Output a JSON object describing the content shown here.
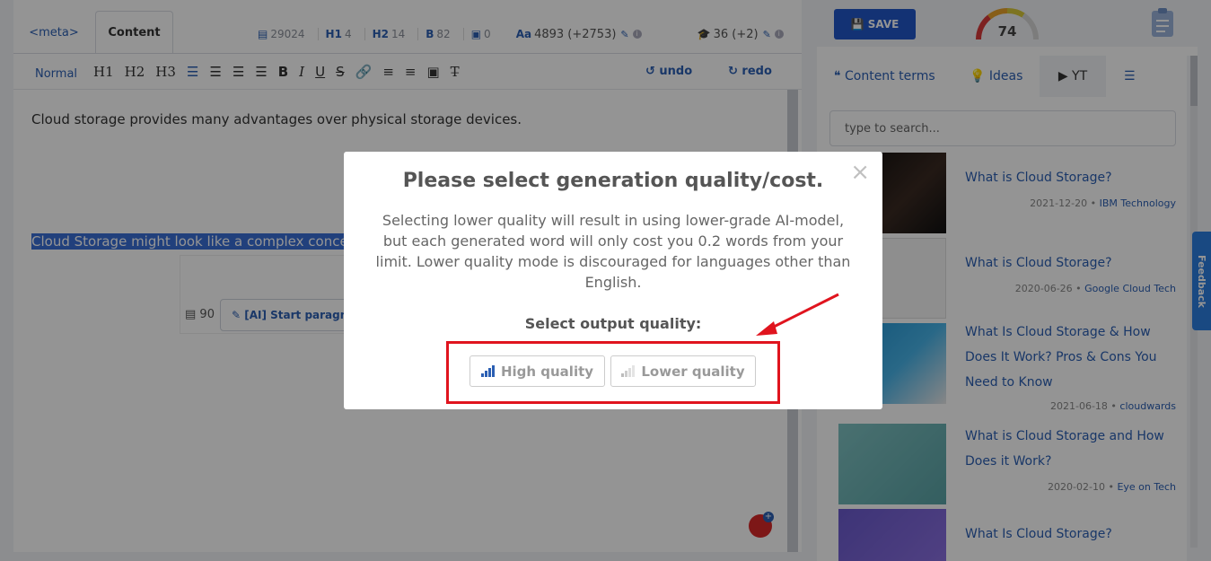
{
  "editor": {
    "tabs": {
      "meta": "<meta>",
      "content": "Content"
    },
    "stats": {
      "words": "29024",
      "h1": "4",
      "h2": "14",
      "bold": "82",
      "images": "0",
      "chars": "4893 (+2753)",
      "grade": "36 (+2)"
    },
    "toolbar": {
      "normal": "Normal",
      "h1": "H1",
      "h2": "H2",
      "h3": "H3",
      "bold": "B",
      "italic": "I",
      "underline": "U",
      "strike": "S",
      "undo": "undo",
      "redo": "redo"
    },
    "document": {
      "para1": "Cloud storage provides many advantages over physical storage devices.",
      "para2": "Cloud Storage might look like a complex concept",
      "ai_count": "90",
      "ai_button": "[AI] Start paragraph"
    }
  },
  "right_panel": {
    "save": "SAVE",
    "score": "74",
    "tabs": {
      "terms": "Content terms",
      "ideas": "Ideas",
      "yt": "YT"
    },
    "search_placeholder": "type to search...",
    "videos": [
      {
        "title": "What is Cloud Storage?",
        "date": "2021-12-20",
        "channel": "IBM Technology"
      },
      {
        "title": "What is Cloud Storage?",
        "date": "2020-06-26",
        "channel": "Google Cloud Tech"
      },
      {
        "title": "What Is Cloud Storage & How Does It Work? Pros & Cons You Need to Know",
        "date": "2021-06-18",
        "channel": "cloudwards"
      },
      {
        "title": "What is Cloud Storage and How Does it Work?",
        "date": "2020-02-10",
        "channel": "Eye on Tech"
      },
      {
        "title": "What Is Cloud Storage?",
        "date": "",
        "channel": ""
      }
    ],
    "feedback": "Feedback"
  },
  "modal": {
    "title": "Please select generation quality/cost.",
    "description": "Selecting lower quality will result in using lower-grade AI-model, but each generated word will only cost you 0.2 words from your limit. Lower quality mode is discouraged for languages other than English.",
    "label": "Select output quality:",
    "high": "High quality",
    "low": "Lower quality",
    "close": "×"
  },
  "colors": {
    "accent": "#2b5fb3",
    "save": "#2156c9",
    "highlight": "#e0141e"
  }
}
